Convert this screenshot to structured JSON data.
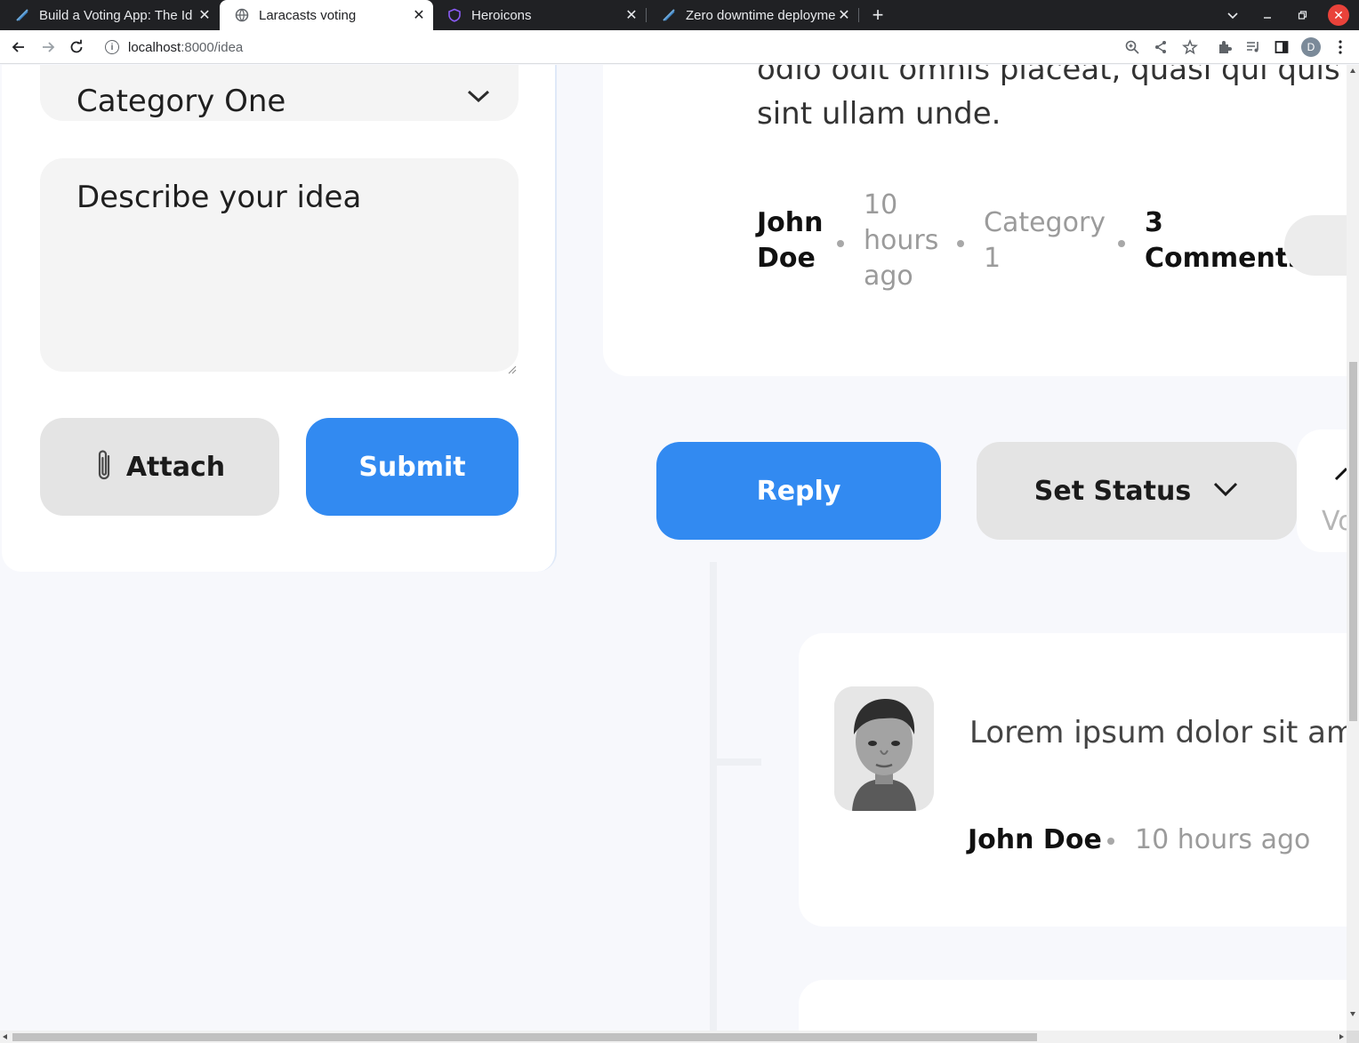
{
  "browser": {
    "tabs": [
      {
        "title": "Build a Voting App: The Id",
        "icon": "laracasts-icon",
        "active": false
      },
      {
        "title": "Laracasts voting",
        "icon": "globe-icon",
        "active": true
      },
      {
        "title": "Heroicons",
        "icon": "heroicons-shield-icon",
        "active": false
      },
      {
        "title": "Zero downtime deployme",
        "icon": "laracasts-icon",
        "active": false
      }
    ],
    "new_tab": "+",
    "url_host": "localhost",
    "url_path": ":8000/idea",
    "profile_initial": "D",
    "accent": "#328af1"
  },
  "form": {
    "category_value": "Category One",
    "description_placeholder": "Describe your idea",
    "attach_label": "Attach",
    "submit_label": "Submit"
  },
  "idea": {
    "description_lines": [
      "odio odit omnis placeat, quasi qui quis qu",
      "sint ullam unde."
    ],
    "author_line1": "John",
    "author_line2": "Doe",
    "time_line1": "10",
    "time_line2": "hours",
    "time_line3": "ago",
    "category_line1": "Category",
    "category_line2": "1",
    "comments_line1": "3",
    "comments_line2": "Comments"
  },
  "actions": {
    "reply_label": "Reply",
    "set_status_label": "Set Status",
    "votes_label": "Vo"
  },
  "comment": {
    "text": "Lorem ipsum dolor sit ame",
    "author": "John Doe",
    "time": "10 hours ago"
  }
}
